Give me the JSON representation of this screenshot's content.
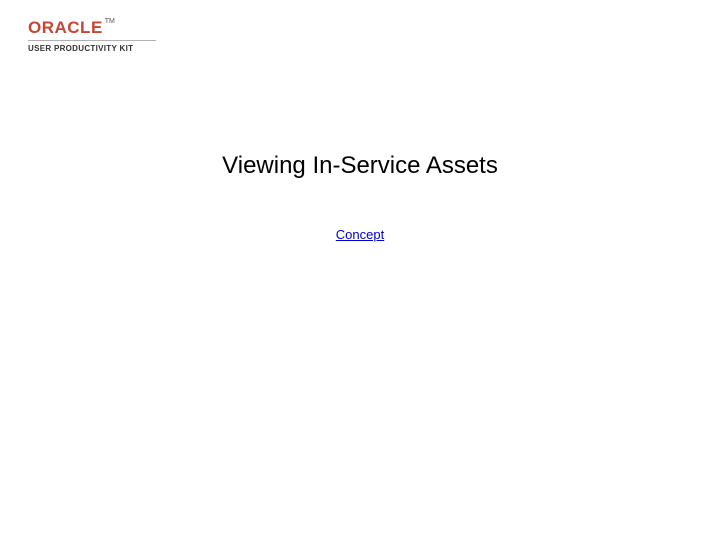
{
  "logo": {
    "brand": "ORACLE",
    "trademark": "TM",
    "subbrand": "USER PRODUCTIVITY KIT"
  },
  "page": {
    "title": "Viewing In-Service Assets",
    "concept_link": "Concept"
  }
}
